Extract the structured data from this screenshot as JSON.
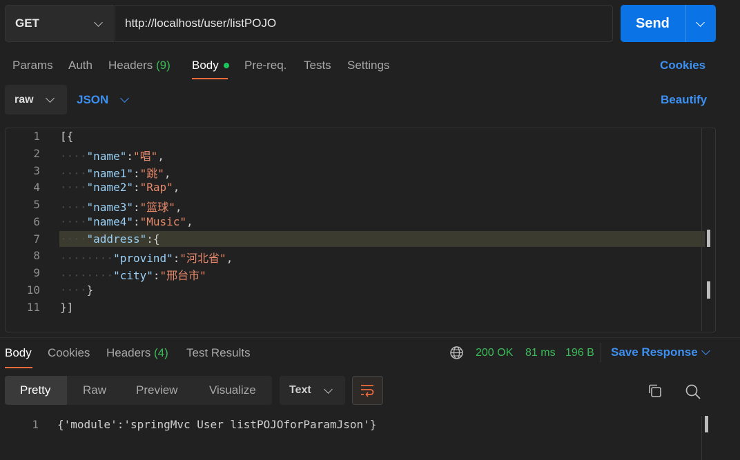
{
  "request": {
    "method": "GET",
    "url": "http://localhost/user/listPOJO",
    "send_label": "Send"
  },
  "request_tabs": {
    "params": "Params",
    "auth": "Auth",
    "headers": "Headers",
    "headers_count": "(9)",
    "body": "Body",
    "prereq": "Pre-req.",
    "tests": "Tests",
    "settings": "Settings",
    "cookies": "Cookies"
  },
  "body_options": {
    "raw": "raw",
    "format": "JSON",
    "beautify": "Beautify"
  },
  "editor": {
    "line_numbers": [
      "1",
      "2",
      "3",
      "4",
      "5",
      "6",
      "7",
      "8",
      "9",
      "10",
      "11"
    ],
    "l1": "[{",
    "l2_key": "\"name\"",
    "l2_val": "\"唱\"",
    "l3_key": "\"name1\"",
    "l3_val": "\"跳\"",
    "l4_key": "\"name2\"",
    "l4_val": "\"Rap\"",
    "l5_key": "\"name3\"",
    "l5_val": "\"篮球\"",
    "l6_key": "\"name4\"",
    "l6_val": "\"Music\"",
    "l7_key": "\"address\"",
    "l8_key": "\"provind\"",
    "l8_val": "\"河北省\"",
    "l9_key": "\"city\"",
    "l9_val": "\"邢台市\"",
    "l10": "}",
    "l11": "}]"
  },
  "response_tabs": {
    "body": "Body",
    "cookies": "Cookies",
    "headers": "Headers",
    "headers_count": "(4)",
    "test_results": "Test Results"
  },
  "response_meta": {
    "status": "200 OK",
    "time": "81 ms",
    "size": "196 B",
    "save": "Save Response"
  },
  "response_view": {
    "pretty": "Pretty",
    "raw": "Raw",
    "preview": "Preview",
    "visualize": "Visualize",
    "type": "Text"
  },
  "response_body": {
    "line_number": "1",
    "text": "{'module':'springMvc User listPOJOforParamJson'}"
  }
}
